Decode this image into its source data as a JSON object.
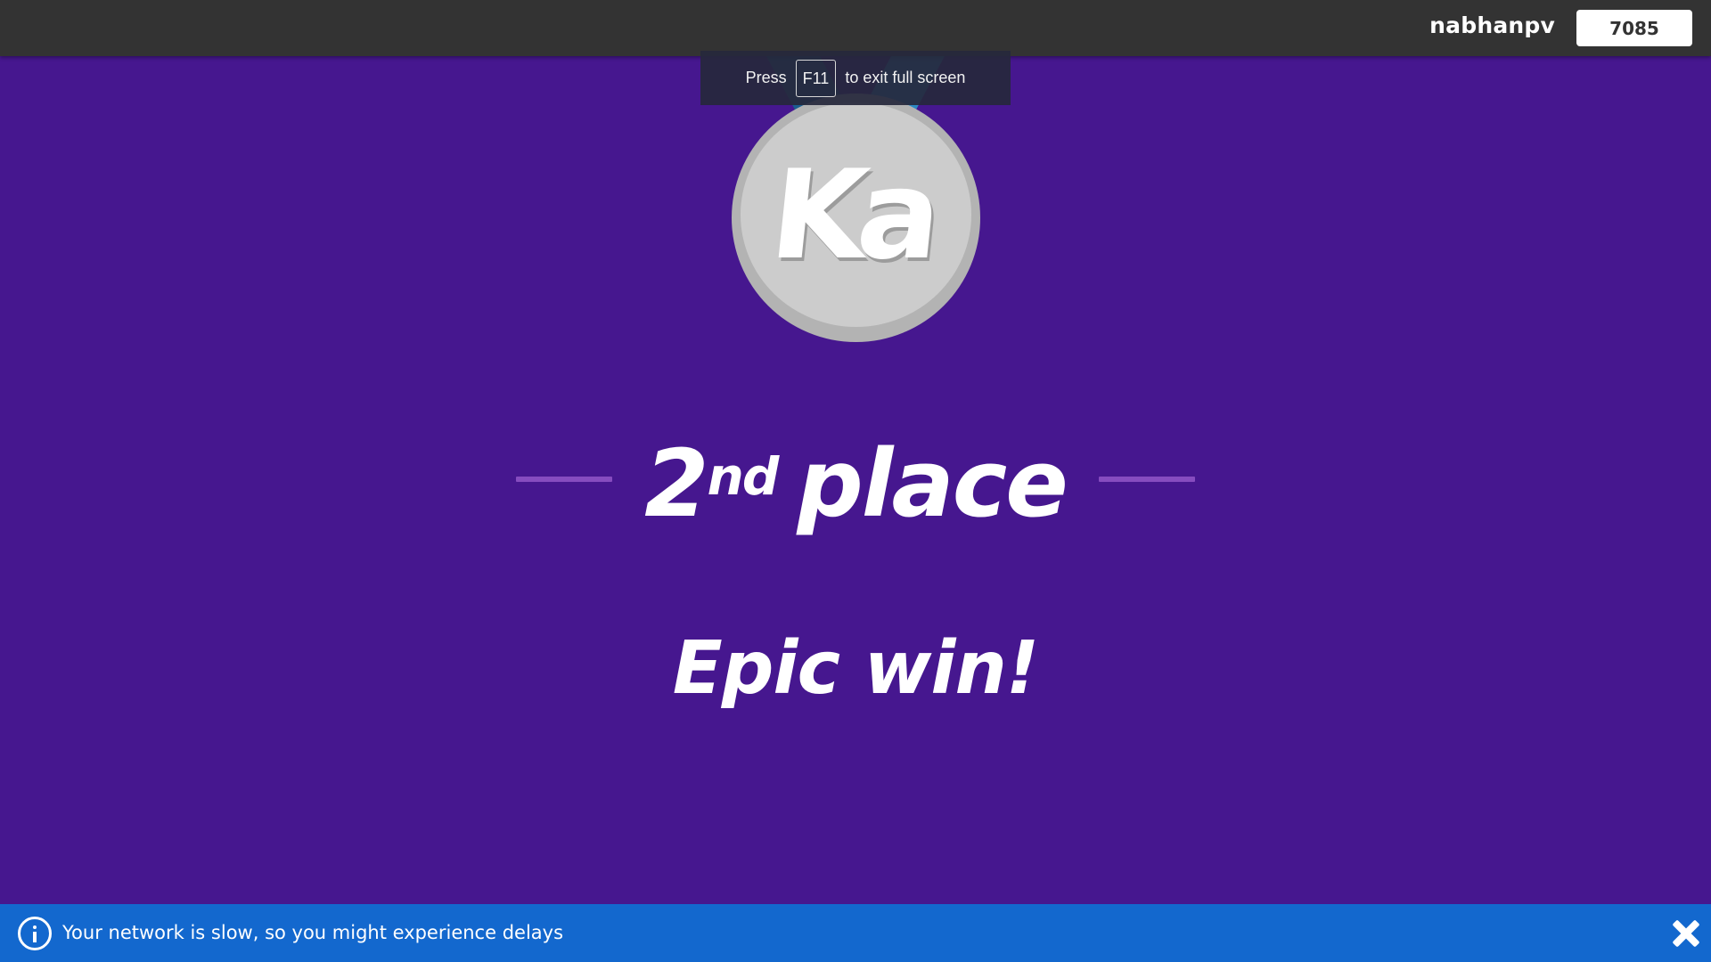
{
  "header": {
    "username": "nabhanpv",
    "score": "7085"
  },
  "fullscreen_toast": {
    "before": "Press",
    "key": "F11",
    "after": "to exit full screen"
  },
  "medal": {
    "text": "Ka"
  },
  "result": {
    "place_number": "2",
    "place_suffix": "nd",
    "place_word": "place",
    "message": "Epic win!"
  },
  "network_banner": {
    "text": "Your network is slow, so you might experience delays"
  },
  "colors": {
    "background": "#46178f",
    "topbar": "#333333",
    "banner": "#1368ce",
    "dash": "#864cbf",
    "medal_silver": "#cccccc"
  }
}
